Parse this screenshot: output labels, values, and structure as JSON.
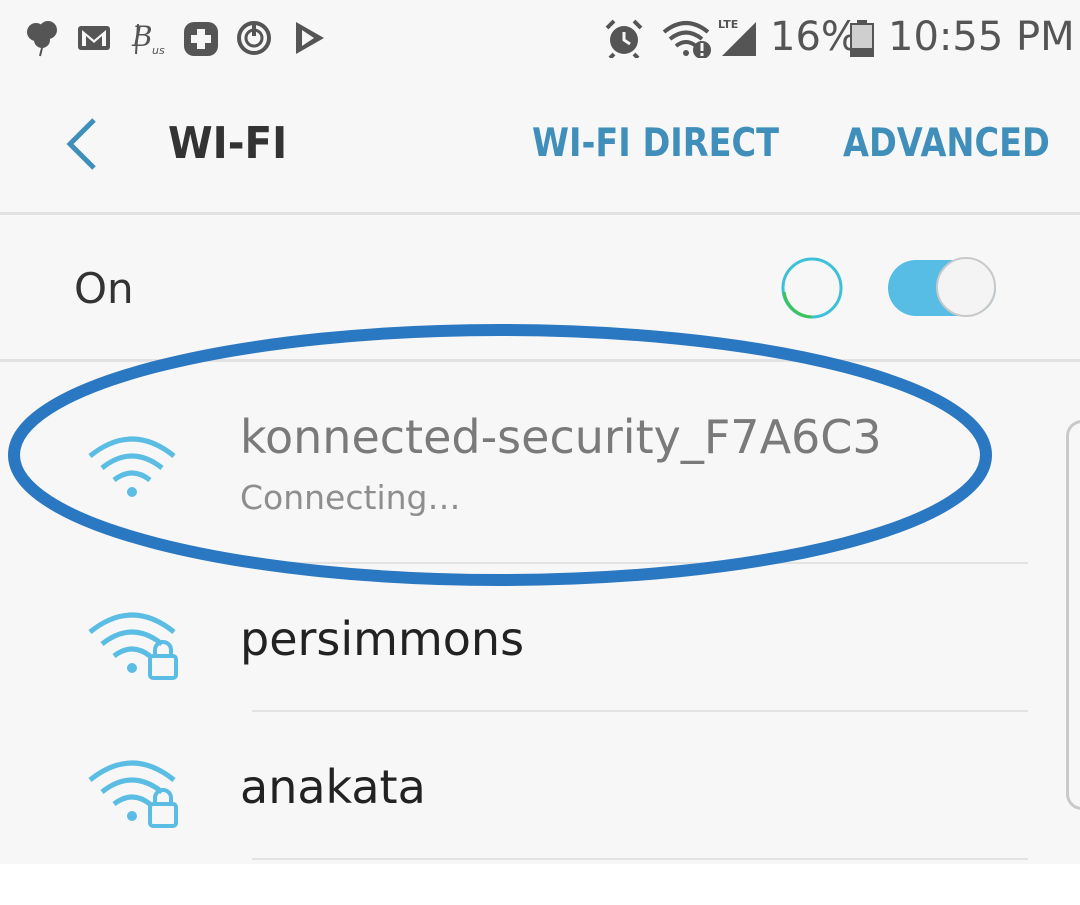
{
  "status_bar": {
    "left_icons": [
      "balloons-icon",
      "gmail-icon",
      "bitcoin-us-icon",
      "health-plus-icon",
      "sync-target-icon",
      "play-store-icon"
    ],
    "right_icons": [
      "alarm-icon",
      "wifi-alert-icon",
      "lte-signal-icon",
      "battery-icon"
    ],
    "lte_label": "LTE",
    "battery": "16%",
    "time": "10:55 PM"
  },
  "app_bar": {
    "title": "WI-FI",
    "actions": {
      "wifi_direct": "WI-FI DIRECT",
      "advanced": "ADVANCED"
    }
  },
  "wifi_toggle": {
    "label": "On",
    "enabled": true
  },
  "networks": [
    {
      "name": "konnected-security_F7A6C3",
      "status": "Connecting…",
      "secured": false
    },
    {
      "name": "persimmons",
      "status": "",
      "secured": true
    },
    {
      "name": "anakata",
      "status": "",
      "secured": true
    }
  ],
  "colors": {
    "accent": "#3f8fba",
    "wifi_icon": "#5bbde3",
    "toggle_on": "#58bde4",
    "annotation_ring": "#2a78c2",
    "spinner_green": "#3cc35a"
  }
}
